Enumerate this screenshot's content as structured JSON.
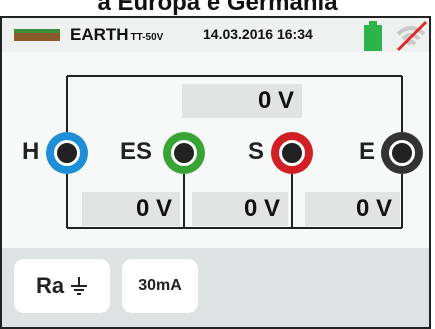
{
  "caption": "a Europa e Germania",
  "status_bar": {
    "mode": "EARTH",
    "mode_sub": "TT-50V",
    "datetime": "14.03.2016 16:34",
    "battery_color": "#2eb34a",
    "wifi_state": "disabled"
  },
  "diagram": {
    "top_reading": {
      "value": "0",
      "unit": "V"
    },
    "terminals": [
      {
        "label": "H",
        "color": "#1e8fd6"
      },
      {
        "label": "ES",
        "color": "#3aa335"
      },
      {
        "label": "S",
        "color": "#d21f26"
      },
      {
        "label": "E",
        "color": "#333333"
      }
    ],
    "bottom_readings": [
      {
        "value": "0",
        "unit": "V"
      },
      {
        "value": "0",
        "unit": "V"
      },
      {
        "value": "0",
        "unit": "V"
      }
    ]
  },
  "footer": {
    "ra_label": "Ra",
    "ra_icon": "earth-ground-icon",
    "current_label": "30mA"
  }
}
